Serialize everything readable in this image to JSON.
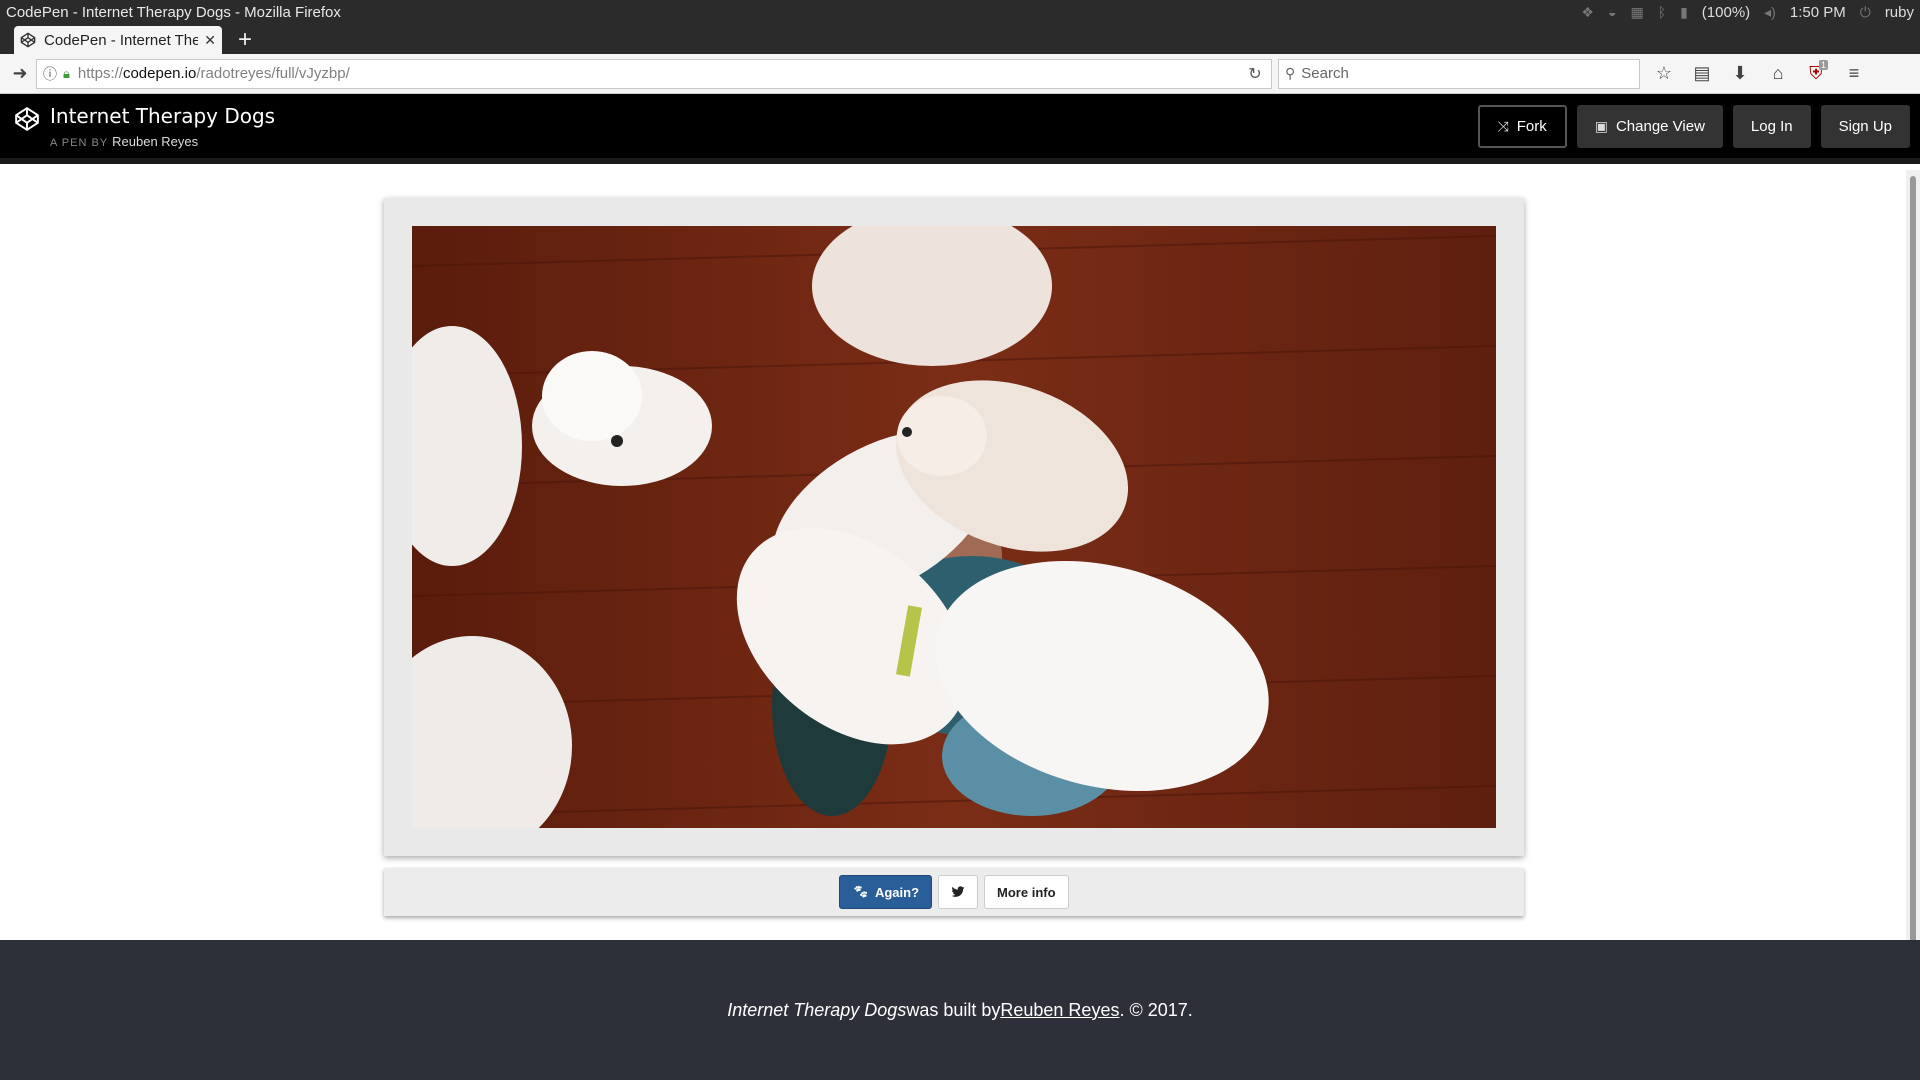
{
  "os": {
    "window_title": "CodePen - Internet Therapy Dogs - Mozilla Firefox",
    "battery": "(100%)",
    "time": "1:50 PM",
    "user": "ruby"
  },
  "browser": {
    "tab_title": "CodePen - Internet The",
    "url_protocol": "https://",
    "url_host": "codepen.io",
    "url_path": "/radotreyes/full/vJyzbp/",
    "search_placeholder": "Search",
    "extension_badge": "1"
  },
  "codepen": {
    "title": "Internet Therapy Dogs",
    "byline_prefix": "A PEN BY",
    "author": "Reuben Reyes",
    "actions": {
      "fork": "Fork",
      "change_view": "Change View",
      "log_in": "Log In",
      "sign_up": "Sign Up"
    }
  },
  "page": {
    "again_label": "Again?",
    "more_info_label": "More info"
  },
  "footer": {
    "project": "Internet Therapy Dogs",
    "built_by": " was built by ",
    "author": "Reuben Reyes",
    "copyright": ". © 2017."
  }
}
